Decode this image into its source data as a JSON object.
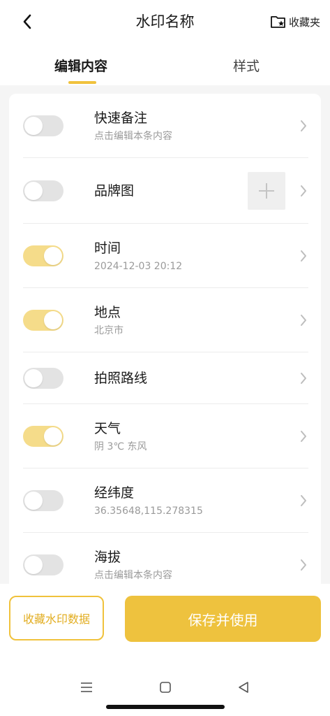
{
  "header": {
    "title": "水印名称",
    "favorites_label": "收藏夹"
  },
  "tabs": [
    {
      "label": "编辑内容",
      "active": true
    },
    {
      "label": "样式",
      "active": false
    }
  ],
  "rows": [
    {
      "title": "快速备注",
      "subtitle": "点击编辑本条内容",
      "enabled": false
    },
    {
      "title": "品牌图",
      "subtitle": "",
      "enabled": false
    },
    {
      "title": "时间",
      "subtitle": "2024-12-03 20:12",
      "enabled": true
    },
    {
      "title": "地点",
      "subtitle": "北京市",
      "enabled": true
    },
    {
      "title": "拍照路线",
      "subtitle": "",
      "enabled": false
    },
    {
      "title": "天气",
      "subtitle": "阴 3℃ 东风",
      "enabled": true
    },
    {
      "title": "经纬度",
      "subtitle": "36.35648,115.278315",
      "enabled": false
    },
    {
      "title": "海拔",
      "subtitle": "点击编辑本条内容",
      "enabled": false
    }
  ],
  "actions": {
    "favorite_data": "收藏水印数据",
    "save_and_use": "保存并使用"
  },
  "colors": {
    "accent": "#eec23e",
    "toggle_on": "#f5dc8a",
    "toggle_off": "#e3e3e3",
    "subtitle": "#9a9a9a"
  }
}
